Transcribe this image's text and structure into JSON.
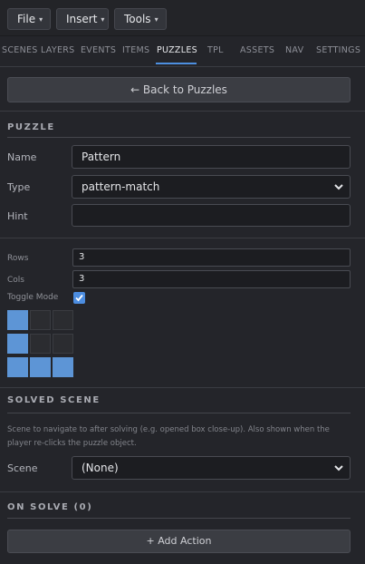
{
  "menubar": {
    "items": [
      {
        "label": "File"
      },
      {
        "label": "Insert"
      },
      {
        "label": "Tools"
      }
    ],
    "caret": "▾"
  },
  "tabs": [
    {
      "label": "SCENES"
    },
    {
      "label": "LAYERS"
    },
    {
      "label": "EVENTS"
    },
    {
      "label": "ITEMS"
    },
    {
      "label": "PUZZLES",
      "active": true
    },
    {
      "label": "TPL"
    },
    {
      "label": "ASSETS"
    },
    {
      "label": "NAV"
    },
    {
      "label": "SETTINGS"
    }
  ],
  "back_button": "← Back to Puzzles",
  "puzzle": {
    "section_title": "PUZZLE",
    "name_label": "Name",
    "name_value": "Pattern",
    "type_label": "Type",
    "type_value": "pattern-match",
    "hint_label": "Hint",
    "hint_value": ""
  },
  "pattern": {
    "rows_label": "Rows",
    "rows_value": "3",
    "cols_label": "Cols",
    "cols_value": "3",
    "toggle_label": "Toggle Mode",
    "toggle_checked": true,
    "cells": [
      [
        true,
        false,
        false
      ],
      [
        true,
        false,
        false
      ],
      [
        true,
        true,
        true
      ]
    ]
  },
  "solved_scene": {
    "section_title": "SOLVED SCENE",
    "description": "Scene to navigate to after solving (e.g. opened box close-up). Also shown when the player re-clicks the puzzle object.",
    "scene_label": "Scene",
    "scene_value": "(None)"
  },
  "on_solve": {
    "section_title": "ON SOLVE (0)",
    "add_action_label": "+ Add Action"
  },
  "colors": {
    "accent": "#4c8de0",
    "cell_on": "#5d95d6",
    "background": "#24252a"
  }
}
